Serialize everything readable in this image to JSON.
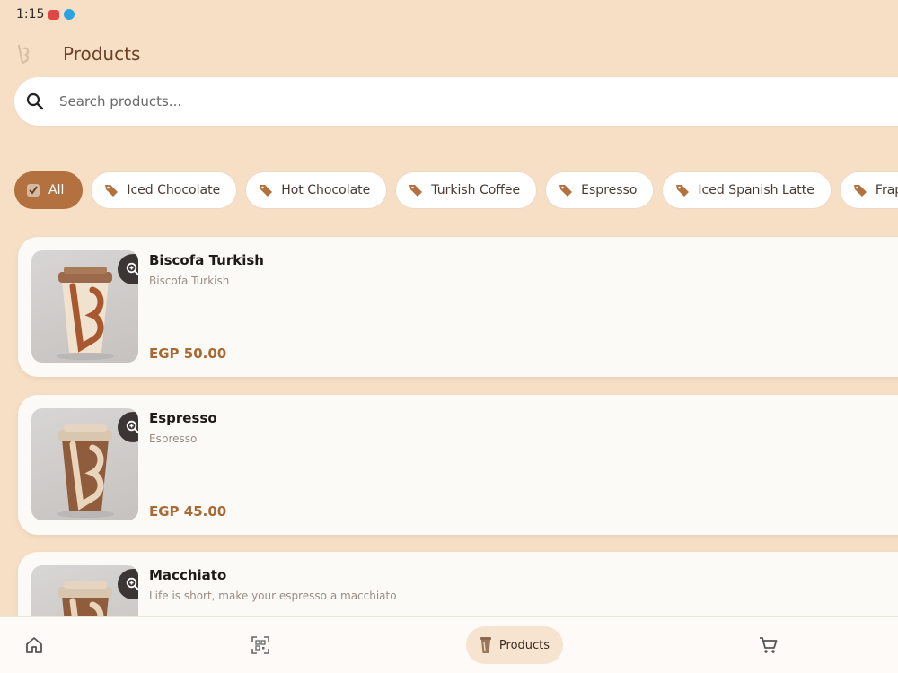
{
  "status_bar": {
    "time": "1:15"
  },
  "header": {
    "title": "Products"
  },
  "search": {
    "placeholder": "Search products..."
  },
  "categories": [
    {
      "label": "All",
      "active": true
    },
    {
      "label": "Iced Chocolate"
    },
    {
      "label": "Hot Chocolate"
    },
    {
      "label": "Turkish Coffee"
    },
    {
      "label": "Espresso"
    },
    {
      "label": "Iced Spanish Latte"
    },
    {
      "label": "Frap"
    }
  ],
  "products": [
    {
      "name": "Biscofa Turkish",
      "description": "Biscofa Turkish",
      "price": "EGP 50.00"
    },
    {
      "name": "Espresso",
      "description": "Espresso",
      "price": "EGP 45.00"
    },
    {
      "name": "Macchiato",
      "description": "Life is short, make your espresso a macchiato",
      "price": ""
    }
  ],
  "bottom_nav": {
    "items": [
      {
        "icon": "home-icon"
      },
      {
        "icon": "qr-scan-icon"
      },
      {
        "icon": "coffee-cup-icon",
        "label": "Products",
        "active": true
      },
      {
        "icon": "cart-icon"
      }
    ]
  },
  "colors": {
    "background": "#f7dfc6",
    "accent": "#b2713f",
    "price": "#a86a34",
    "card": "#fcfaf7"
  }
}
